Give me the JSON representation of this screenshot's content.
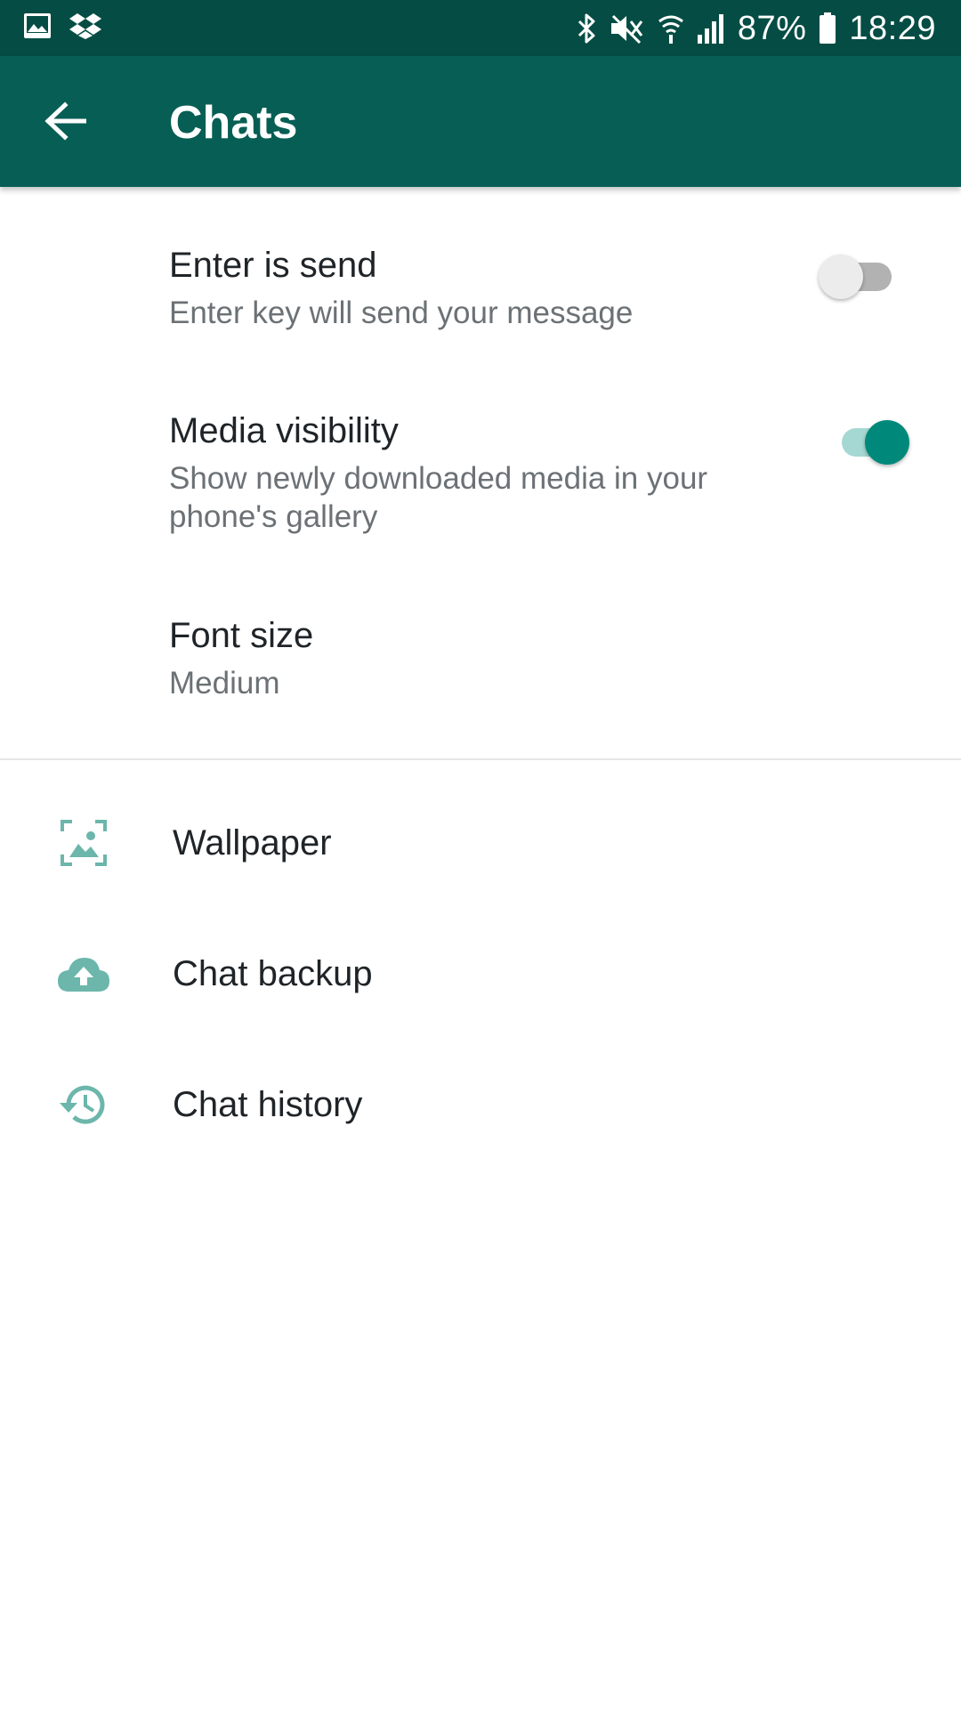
{
  "status_bar": {
    "battery": "87%",
    "time": "18:29",
    "left_icons": [
      "gallery-icon",
      "dropbox-icon"
    ],
    "right_icons": [
      "bluetooth-icon",
      "mute-icon",
      "wifi-icon",
      "signal-icon",
      "battery-icon"
    ]
  },
  "toolbar": {
    "title": "Chats",
    "back_icon": "arrow-back-icon"
  },
  "settings": {
    "enter_is_send": {
      "title": "Enter is send",
      "subtitle": "Enter key will send your message",
      "enabled": false
    },
    "media_visibility": {
      "title": "Media visibility",
      "subtitle": "Show newly downloaded media in your phone's gallery",
      "enabled": true
    },
    "font_size": {
      "title": "Font size",
      "value": "Medium"
    }
  },
  "items": {
    "wallpaper": {
      "label": "Wallpaper",
      "icon": "wallpaper-icon"
    },
    "chat_backup": {
      "label": "Chat backup",
      "icon": "cloud-upload-icon"
    },
    "chat_history": {
      "label": "Chat history",
      "icon": "history-icon"
    }
  },
  "colors": {
    "status_bar": "#054d44",
    "toolbar": "#075e54",
    "accent": "#00897b",
    "icon_tint": "#6cb6ab",
    "primary_text": "#1f2428",
    "secondary_text": "#6b7175"
  }
}
